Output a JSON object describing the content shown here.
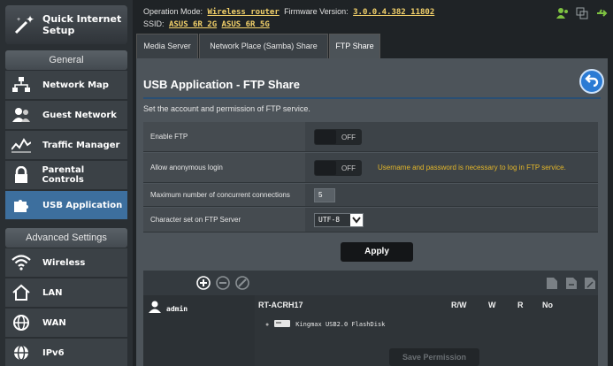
{
  "sidebar": {
    "quick_setup": "Quick Internet Setup",
    "general_header": "General",
    "general_items": [
      {
        "label": "Network Map",
        "icon": "network-map-icon"
      },
      {
        "label": "Guest Network",
        "icon": "guest-network-icon"
      },
      {
        "label": "Traffic Manager",
        "icon": "traffic-manager-icon"
      },
      {
        "label": "Parental Controls",
        "icon": "lock-icon"
      },
      {
        "label": "USB Application",
        "icon": "puzzle-icon"
      }
    ],
    "advanced_header": "Advanced Settings",
    "advanced_items": [
      {
        "label": "Wireless",
        "icon": "wifi-icon"
      },
      {
        "label": "LAN",
        "icon": "home-icon"
      },
      {
        "label": "WAN",
        "icon": "globe-icon"
      },
      {
        "label": "IPv6",
        "icon": "ipv6-globe-icon"
      }
    ]
  },
  "header": {
    "mode_label": "Operation Mode:",
    "mode_value": "Wireless router",
    "firmware_label": "Firmware Version:",
    "firmware_value": "3.0.0.4.382_11802",
    "ssid_label": "SSID:",
    "ssid_values": [
      "ASUS_6R_2G",
      "ASUS_6R_5G"
    ]
  },
  "tabs": [
    "Media Server",
    "Network Place (Samba) Share",
    "FTP Share"
  ],
  "page": {
    "title": "USB Application - FTP Share",
    "description": "Set the account and permission of FTP service.",
    "enable_ftp_label": "Enable FTP",
    "enable_ftp_state": "OFF",
    "anon_label": "Allow anonymous login",
    "anon_state": "OFF",
    "anon_note": "Username and password is necessary to log in FTP service.",
    "max_conn_label": "Maximum number of concurrent connections",
    "max_conn_value": "5",
    "charset_label": "Character set on FTP Server",
    "charset_value": "UTF-8",
    "apply_label": "Apply"
  },
  "permissions": {
    "user": "admin",
    "device": "RT-ACRH17",
    "columns": [
      "R/W",
      "W",
      "R",
      "No"
    ],
    "disk": "Kingmax USB2.0 FlashDisk",
    "save_label": "Save Permission"
  },
  "colors": {
    "accent": "#3d6f9e",
    "highlight": "#f3d16a",
    "note": "#e3b629",
    "back_button": "#2b7bd4"
  }
}
